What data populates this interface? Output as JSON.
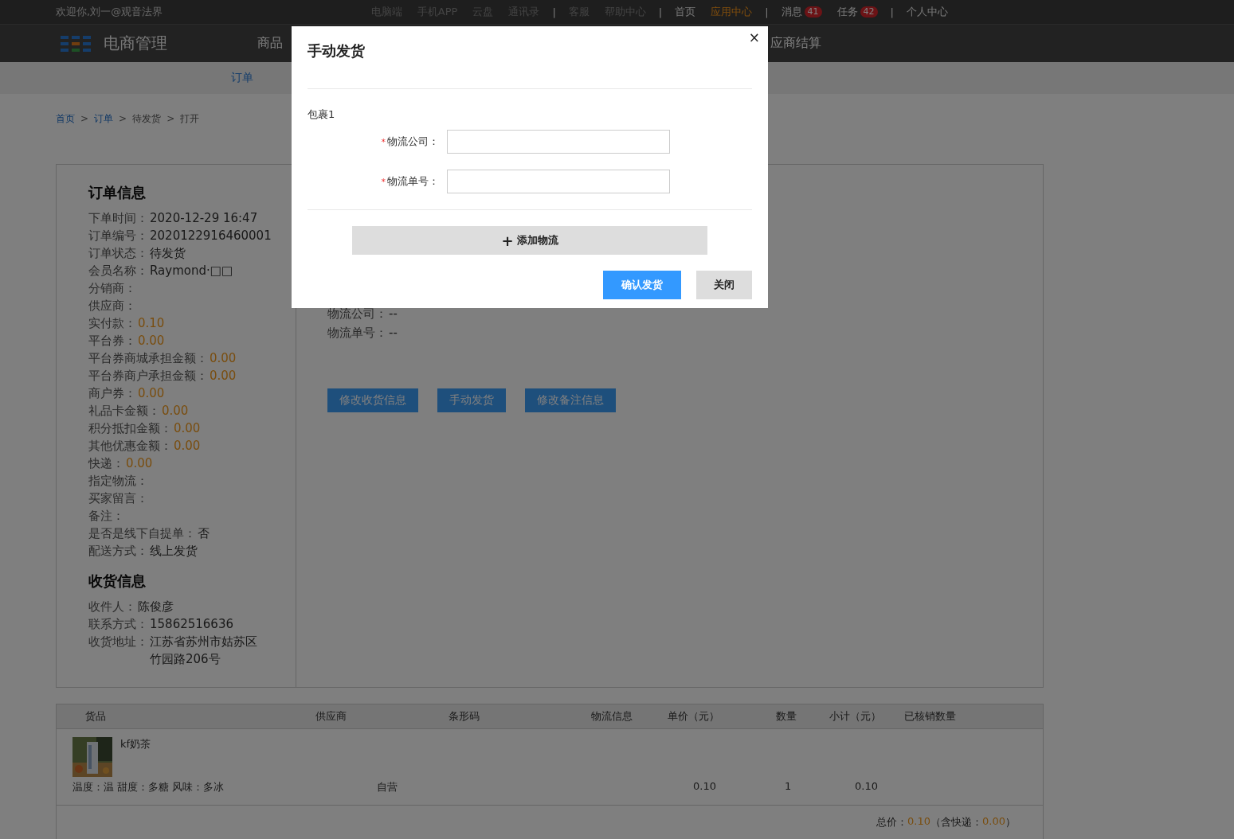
{
  "top_bar": {
    "greeting": "欢迎你,刘一@观音法界",
    "link_groups": [
      [
        {
          "label": "电脑端",
          "dimmed": true,
          "selected": false
        },
        {
          "label": "手机APP",
          "dimmed": true,
          "selected": false
        },
        {
          "label": "云盘",
          "dimmed": true,
          "selected": false
        },
        {
          "label": "通讯录",
          "dimmed": true,
          "selected": false
        }
      ],
      [
        {
          "label": "客服",
          "dimmed": true,
          "selected": false
        },
        {
          "label": "帮助中心",
          "dimmed": true,
          "selected": false
        }
      ],
      [
        {
          "label": "首页",
          "dimmed": false,
          "selected": false
        },
        {
          "label": "应用中心",
          "dimmed": false,
          "selected": true
        }
      ],
      [
        {
          "label": "消息",
          "dimmed": false,
          "selected": false,
          "badge": "41"
        },
        {
          "label": "任务",
          "dimmed": false,
          "selected": false,
          "badge": "42"
        }
      ],
      [
        {
          "label": "个人中心",
          "dimmed": false,
          "selected": false
        }
      ]
    ],
    "separator": "|"
  },
  "header": {
    "app_name": "电商管理",
    "nav": [
      "商品",
      "应商结算"
    ]
  },
  "sub_nav": [
    {
      "label": "订单",
      "selected": true
    }
  ],
  "breadcrumb": [
    {
      "label": "首页",
      "kind": "link"
    },
    {
      "label": ">",
      "kind": "sep"
    },
    {
      "label": "订单",
      "kind": "link"
    },
    {
      "label": ">",
      "kind": "sep"
    },
    {
      "label": "待发货",
      "kind": "text"
    },
    {
      "label": ">",
      "kind": "sep"
    },
    {
      "label": "打开",
      "kind": "text"
    }
  ],
  "order_info": {
    "title": "订单信息",
    "fields": [
      {
        "label": "下单时间：",
        "value": "2020-12-29 16:47",
        "kind": "plain"
      },
      {
        "label": "订单编号：",
        "value": "2020122916460001",
        "kind": "plain"
      },
      {
        "label": "订单状态：",
        "value": "待发货",
        "kind": "plain"
      },
      {
        "label": "会员名称：",
        "value": "Raymond·□□",
        "kind": "plain"
      },
      {
        "label": "分销商：",
        "kind": "plain"
      },
      {
        "label": "供应商：",
        "kind": "plain"
      },
      {
        "label": "实付款：",
        "value": "0.10",
        "kind": "money"
      },
      {
        "label": "平台券：",
        "value": "0.00",
        "kind": "money"
      },
      {
        "label": "平台券商城承担金额：",
        "value": "0.00",
        "kind": "money"
      },
      {
        "label": "平台券商户承担金额：",
        "value": "0.00",
        "kind": "money"
      },
      {
        "label": "商户券：",
        "value": "0.00",
        "kind": "money"
      },
      {
        "label": "礼品卡金额：",
        "value": "0.00",
        "kind": "money"
      },
      {
        "label": "积分抵扣金额：",
        "value": "0.00",
        "kind": "money"
      },
      {
        "label": "其他优惠金额：",
        "value": "0.00",
        "kind": "money"
      },
      {
        "label": "快递：",
        "value": "0.00",
        "kind": "money"
      },
      {
        "label": "指定物流：",
        "kind": "plain"
      },
      {
        "label": "买家留言：",
        "kind": "plain"
      },
      {
        "label": "备注：",
        "kind": "plain"
      },
      {
        "label": "是否是线下自提单：",
        "value": "否",
        "kind": "plain"
      },
      {
        "label": "配送方式：",
        "value": "线上发货",
        "kind": "plain"
      }
    ]
  },
  "receiver_info": {
    "title": "收货信息",
    "fields": [
      {
        "label": "收件人：",
        "value": "陈俊彦"
      },
      {
        "label": "联系方式：",
        "value": "15862516636"
      },
      {
        "label": "收货地址：",
        "value": "江苏省苏州市姑苏区竹园路206号"
      }
    ]
  },
  "logistics": {
    "company": {
      "label": "物流公司：",
      "value": "--"
    },
    "tracking_number": {
      "label": "物流单号：",
      "value": "--"
    },
    "actions": [
      "修改收货信息",
      "手动发货",
      "修改备注信息"
    ]
  },
  "goods_table": {
    "columns": [
      "货品",
      "供应商",
      "条形码",
      "物流信息",
      "单价（元）",
      "数量",
      "小计（元）",
      "已核销数量"
    ],
    "rows": [
      {
        "name": "kf奶茶",
        "specs": "温度：温 甜度：多糖 风味：多冰",
        "supplier": "自营",
        "price": "0.10",
        "quantity": "1",
        "subtotal": "0.10"
      }
    ],
    "total_label": "总价：",
    "total": "0.10",
    "shipping_label": "（含快递：",
    "shipping": "0.00",
    "closing": "）"
  },
  "dialog": {
    "title": "手动发货",
    "close": "×",
    "package_title": "包裹1",
    "fields": [
      {
        "label": "物流公司：",
        "required": true,
        "required_mark": "*"
      },
      {
        "label": "物流单号：",
        "required": true,
        "required_mark": "*"
      }
    ],
    "add_button": {
      "icon": "+",
      "label": "添加物流"
    },
    "buttons": [
      {
        "label": "确认发货",
        "kind": "primary"
      },
      {
        "label": "关闭",
        "kind": "secondary"
      }
    ]
  }
}
